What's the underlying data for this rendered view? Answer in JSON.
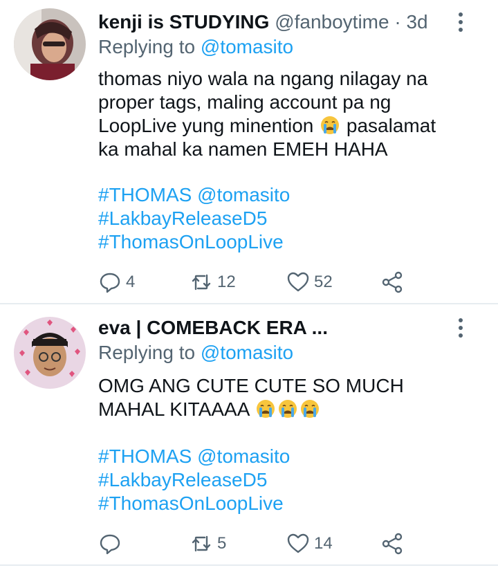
{
  "tweets": [
    {
      "display_name": "kenji is STUDYING",
      "handle": "@fanboytime",
      "separator": "·",
      "time": "3d",
      "replying_prefix": "Replying to",
      "replying_to": "@tomasito",
      "body": {
        "line1": "thomas niyo wala na ngang nilagay na",
        "line2": "proper tags, maling account pa ng",
        "line3_before": "LoopLive yung minention",
        "line3_after": "pasalamat",
        "line4": "ka mahal ka namen EMEH HAHA"
      },
      "tags": [
        "#THOMAS @tomasito",
        "#LakbayReleaseD5",
        "#ThomasOnLoopLive"
      ],
      "replies": "4",
      "retweets": "12",
      "likes": "52"
    },
    {
      "display_name": "eva | COMEBACK ERA ...",
      "replying_prefix": "Replying to",
      "replying_to": "@tomasito",
      "body": {
        "line1": "OMG ANG CUTE CUTE SO MUCH",
        "line2": "MAHAL KITAAAA"
      },
      "tags": [
        "#THOMAS @tomasito",
        "#LakbayReleaseD5",
        "#ThomasOnLoopLive"
      ],
      "replies": "",
      "retweets": "5",
      "likes": "14"
    }
  ],
  "colors": {
    "link": "#1da1f2",
    "secondary_text": "#536471",
    "primary_text": "#0f1419",
    "divider": "#e6ecf0"
  },
  "icons": [
    "more-vertical-icon",
    "reply-icon",
    "retweet-icon",
    "like-icon",
    "share-icon",
    "crying-emoji-icon"
  ]
}
